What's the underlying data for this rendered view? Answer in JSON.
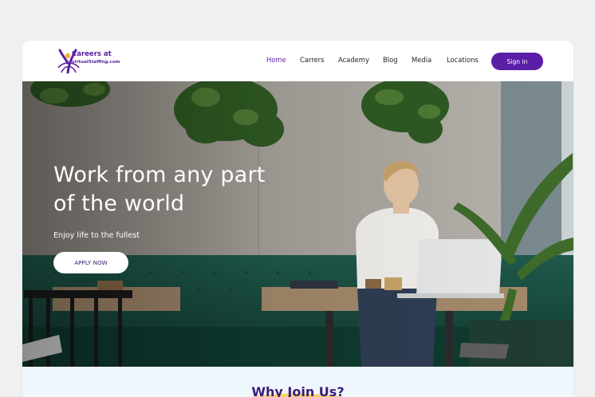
{
  "brand": {
    "line1": "Careers at",
    "line2": "virtualStaffing.com",
    "accent_color": "#5b1ea6"
  },
  "nav": {
    "items": [
      {
        "label": "Home",
        "active": true
      },
      {
        "label": "Carrers",
        "active": false
      },
      {
        "label": "Academy",
        "active": false
      },
      {
        "label": "Blog",
        "active": false
      },
      {
        "label": "Media",
        "active": false
      },
      {
        "label": "Locations",
        "active": false
      }
    ],
    "signin_label": "Sign in"
  },
  "hero": {
    "title": "Work from any part of the world",
    "subtitle": "Enjoy life to the fullest",
    "cta_label": "APPLY NOW",
    "image": "woman-working-on-laptop-in-cafe"
  },
  "section": {
    "title": "Why Join Us?"
  }
}
